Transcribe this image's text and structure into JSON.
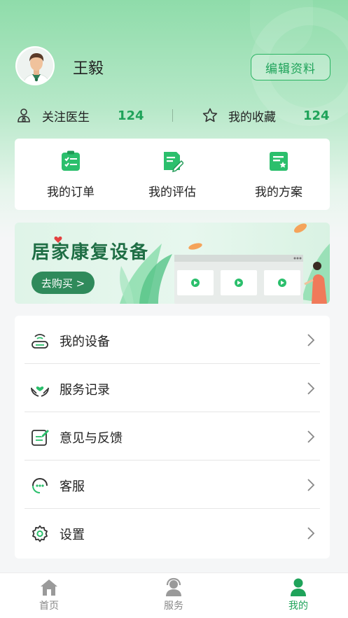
{
  "profile": {
    "name": "王毅",
    "edit_label": "编辑资料"
  },
  "stats": {
    "follow_doctor_label": "关注医生",
    "follow_doctor_count": "124",
    "favorites_label": "我的收藏",
    "favorites_count": "124"
  },
  "quick_actions": [
    {
      "label": "我的订单",
      "icon": "order-clipboard-icon"
    },
    {
      "label": "我的评估",
      "icon": "assessment-edit-icon"
    },
    {
      "label": "我的方案",
      "icon": "plan-star-icon"
    }
  ],
  "banner": {
    "title": "居家康复设备",
    "button_label": "去购买 >"
  },
  "menu": [
    {
      "label": "我的设备",
      "icon": "device-router-icon"
    },
    {
      "label": "服务记录",
      "icon": "service-hands-icon"
    },
    {
      "label": "意见与反馈",
      "icon": "feedback-edit-icon"
    },
    {
      "label": "客服",
      "icon": "customer-service-icon"
    },
    {
      "label": "设置",
      "icon": "gear-icon"
    }
  ],
  "tabbar": [
    {
      "label": "首页",
      "icon": "home-icon",
      "active": false
    },
    {
      "label": "服务",
      "icon": "service-headset-icon",
      "active": false
    },
    {
      "label": "我的",
      "icon": "user-icon",
      "active": true
    }
  ],
  "colors": {
    "accent": "#1fa35a",
    "header_gradient_top": "#8fdcaa",
    "banner_button": "#2f8a5b"
  }
}
